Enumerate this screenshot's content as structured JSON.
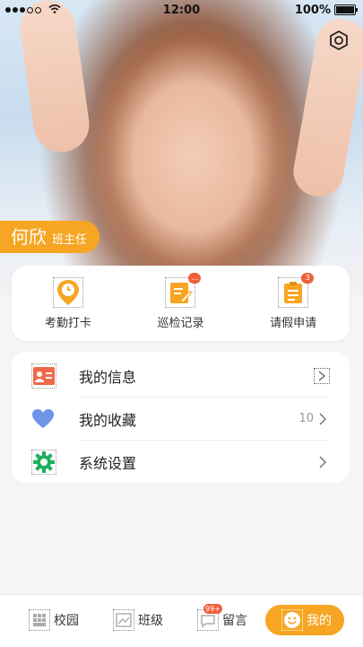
{
  "status_bar": {
    "time": "12:00",
    "battery": "100%"
  },
  "profile": {
    "name": "何欣",
    "role": "班主任"
  },
  "quick_actions": [
    {
      "label": "考勤打卡",
      "icon": "location-clock-icon"
    },
    {
      "label": "巡检记录",
      "icon": "inspection-edit-icon",
      "badge": "…"
    },
    {
      "label": "请假申请",
      "icon": "leave-clipboard-icon",
      "badge": "3"
    }
  ],
  "menu": [
    {
      "label": "我的信息",
      "icon": "id-card-icon",
      "value": ""
    },
    {
      "label": "我的收藏",
      "icon": "heart-icon",
      "value": "10"
    },
    {
      "label": "系统设置",
      "icon": "gear-icon",
      "value": ""
    }
  ],
  "bottom_nav": [
    {
      "label": "校园",
      "icon": "campus-icon"
    },
    {
      "label": "班级",
      "icon": "class-icon"
    },
    {
      "label": "留言",
      "icon": "message-icon",
      "badge": "99+"
    },
    {
      "label": "我的",
      "icon": "profile-smile-icon",
      "active": true
    }
  ],
  "colors": {
    "accent": "#f6a623",
    "badge": "#f0603a",
    "heart": "#6f94e8",
    "gear": "#1fae5b",
    "id_card": "#ee6a4a"
  }
}
